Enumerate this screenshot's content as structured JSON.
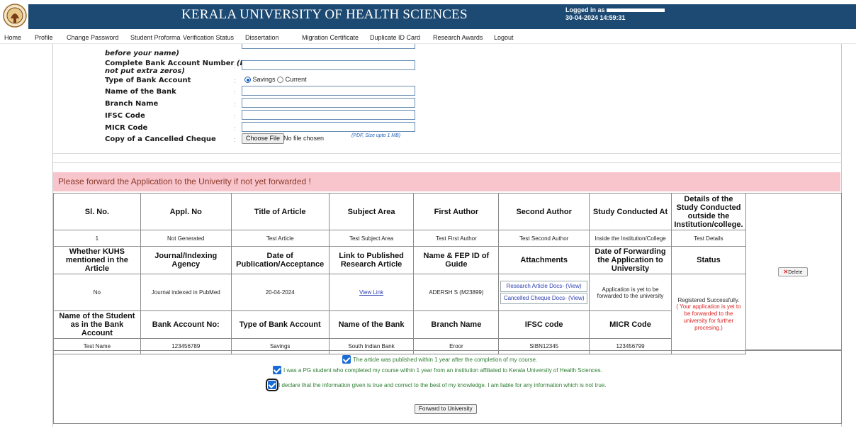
{
  "header": {
    "title": "KERALA UNIVERSITY OF HEALTH SCIENCES",
    "logged_in_label": "Logged in as",
    "datetime": "30-04-2024 14:59:31"
  },
  "nav": {
    "items": [
      "Home",
      "Profile",
      "Change Password",
      "Student Proforma",
      "Verification Status",
      "Dissertation",
      "Migration Certificate",
      "Duplicate ID Card",
      "Research Awards",
      "Logout"
    ]
  },
  "form": {
    "name_note": "before your name)",
    "account_number_label": "Complete Bank Account Number",
    "account_number_note": "(Do",
    "account_number_note2": "not put extra zeros)",
    "account_type_label": "Type of Bank Account",
    "account_type_options": [
      "Savings",
      "Current"
    ],
    "account_type_selected": "Savings",
    "bank_name_label": "Name of the Bank",
    "branch_name_label": "Branch Name",
    "ifsc_label": "IFSC Code",
    "micr_label": "MICR Code",
    "cheque_label": "Copy of a Cancelled Cheque",
    "choose_file_label": "Choose File",
    "no_file_text": "No file chosen",
    "file_hint": "(PDF, Size upto 1 MB)",
    "colon": ":"
  },
  "banner": "Please forward the Application to the Univerity if not yet forwarded !",
  "table": {
    "headers1": [
      "Sl. No.",
      "Appl. No",
      "Title of Article",
      "Subject Area",
      "First Author",
      "Second Author",
      "Study Conducted At",
      "Details of the Study Conducted outside the Institution/college."
    ],
    "row1": [
      "1",
      "Not Generated",
      "Test Article",
      "Test Subject Area",
      "Test First Author",
      "Test Second Author",
      "Inside the Institution/College",
      "Test Details"
    ],
    "headers2": [
      "Whether KUHS mentioned in the Article",
      "Journal/Indexing Agency",
      "Date of Publication/Acceptance",
      "Link to Published Research Article",
      "Name & FEP ID of Guide",
      "Attachments",
      "Date of Forwarding the Application to University",
      "Status"
    ],
    "row2": {
      "kuhs_mentioned": "No",
      "journal": "Journal indexed in PubMed",
      "date": "20-04-2024",
      "link_text": "View Link",
      "guide": "ADERSH S (M23899)",
      "attachment1": "Research Article Docs- (View)",
      "attachment2": "Cancelled Cheque Docs- (View)",
      "forwarding": "Application is yet to be forwarded to the university",
      "status_main": "Registered Successfully.",
      "status_note": "( Your application is yet to be forwarded to the university for further procesing.)"
    },
    "headers3": [
      "Name of the Student as in the Bank Account",
      "Bank Account No:",
      "Type of Bank Account",
      "Name of the Bank",
      "Branch Name",
      "IFSC code",
      "MICR Code"
    ],
    "row3": [
      "Test Name",
      "123456789",
      "Savings",
      "South Indian Bank",
      "Eroor",
      "SIBN12345",
      "123456799"
    ],
    "delete_label": "Delete"
  },
  "declarations": {
    "d1": "The article was published within 1 year after the completion of my course.",
    "d2": "I was a PG student who completed my course within 1 year from an institution affiliated to Kerala University of Health Sciences.",
    "d3": "I declare that the information given is true and correct to the best of my knowledge. I am liable for any information which is not true.",
    "forward_button": "Forward to University"
  },
  "colors": {
    "header_bg": "#1d4a73",
    "banner_bg": "#f9c5cc",
    "decl_text": "#2e7d32",
    "status_red": "#dd2222"
  }
}
